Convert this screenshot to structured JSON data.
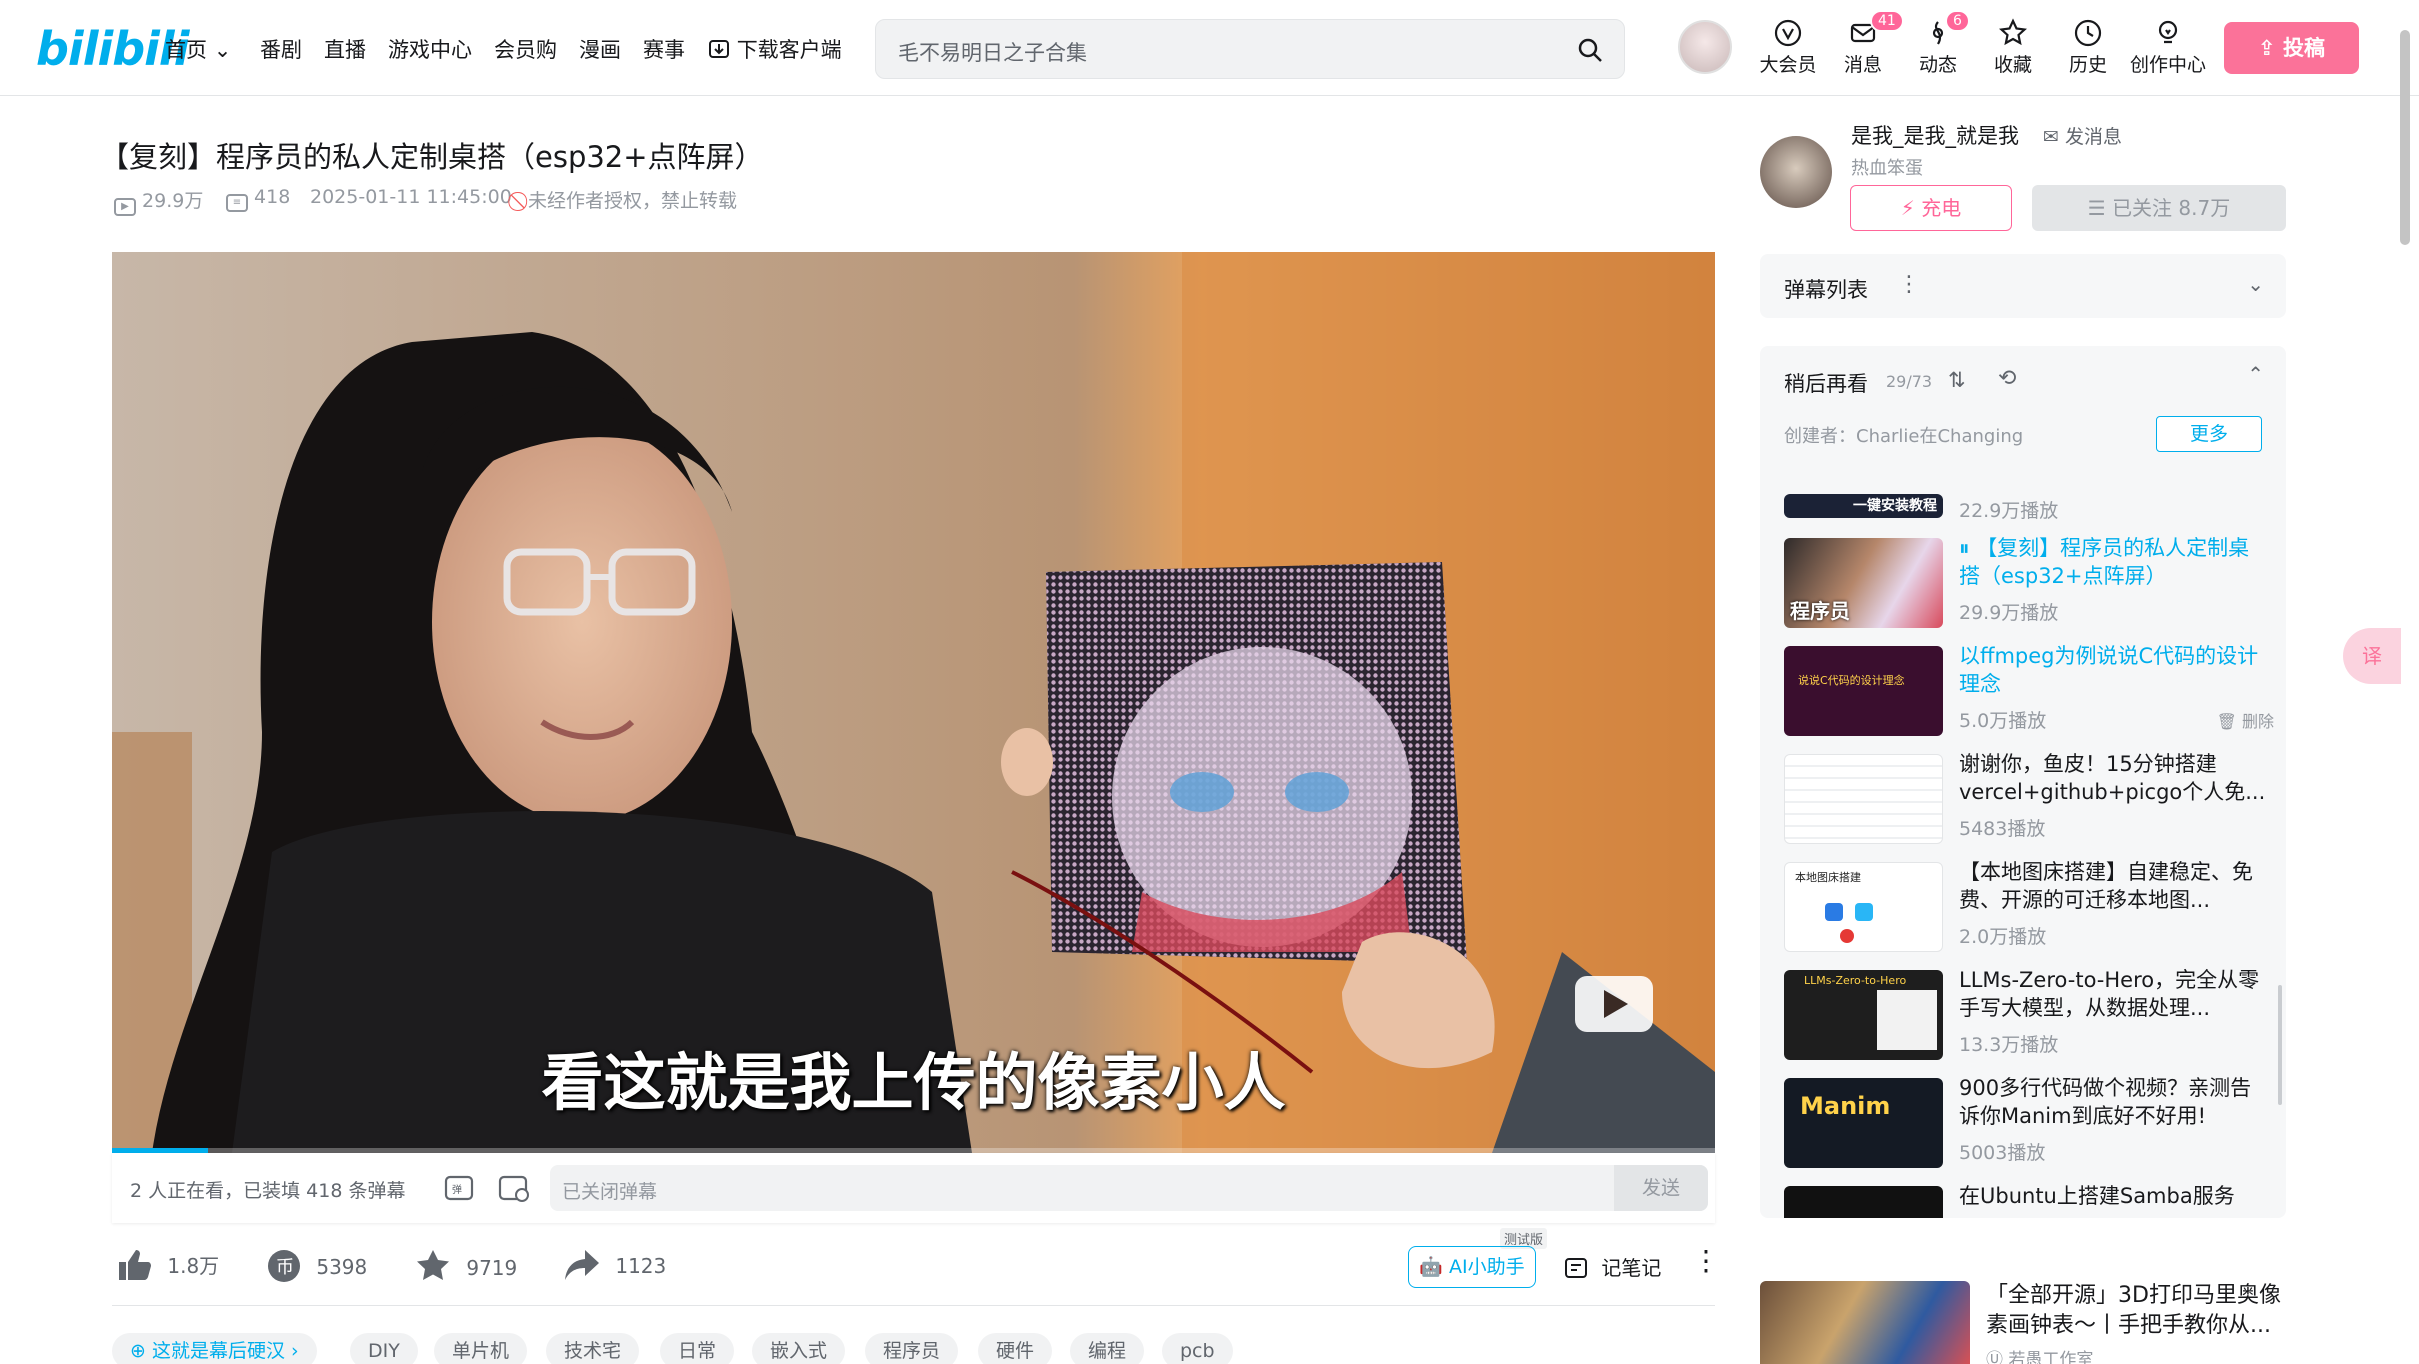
{
  "header": {
    "logo": "bilibili",
    "nav": [
      "首页",
      "番剧",
      "直播",
      "游戏中心",
      "会员购",
      "漫画",
      "赛事",
      "下载客户端"
    ],
    "search_placeholder": "毛不易明日之子合集",
    "icons": [
      {
        "name": "大会员",
        "icon": "vip-icon"
      },
      {
        "name": "消息",
        "icon": "message-icon",
        "badge": "41"
      },
      {
        "name": "动态",
        "icon": "dynamic-icon",
        "badge": "6"
      },
      {
        "name": "收藏",
        "icon": "favorite-icon"
      },
      {
        "name": "历史",
        "icon": "history-icon"
      },
      {
        "name": "创作中心",
        "icon": "creator-icon"
      }
    ],
    "upload": "投稿"
  },
  "video": {
    "title": "【复刻】程序员的私人定制桌搭（esp32+点阵屏）",
    "views": "29.9万",
    "danmaku": "418",
    "date": "2025-01-11 11:45:00",
    "copyright": "未经作者授权，禁止转载",
    "subtitle": "看这就是我上传的像素小人",
    "progress": 0.06
  },
  "danmaku_bar": {
    "viewers": "2 人正在看，已装填 418 条弹幕",
    "placeholder": "已关闭弹幕",
    "send": "发送"
  },
  "toolbar": {
    "like": "1.8万",
    "coin": "5398",
    "fav": "9719",
    "share": "1123",
    "ai": "AI小助手",
    "beta": "测试版",
    "note": "记笔记"
  },
  "tags": [
    "这就是幕后硬汉",
    "DIY",
    "单片机",
    "技术宅",
    "日常",
    "嵌入式",
    "程序员",
    "硬件",
    "编程",
    "pcb"
  ],
  "up": {
    "name": "是我_是我_就是我",
    "msg": "发消息",
    "desc": "热血笨蛋",
    "charge": "充电",
    "follow": "已关注 8.7万"
  },
  "danmaku_list": {
    "title": "弹幕列表"
  },
  "watch_later": {
    "title": "稍后再看",
    "count": "29/73",
    "creator": "创建者：Charlie在Changing",
    "more": "更多",
    "items": [
      {
        "title": "",
        "plays": "22.9万播放",
        "thumb_text": "一键安装教程"
      },
      {
        "title": "【复刻】程序员的私人定制桌搭（esp32+点阵屏）",
        "plays": "29.9万播放",
        "active": true,
        "thumb_text": "程序员"
      },
      {
        "title": "以ffmpeg为例说说C代码的设计理念",
        "plays": "5.0万播放",
        "active": true,
        "delete": "删除",
        "thumb_text": "说说C代码的设计理念"
      },
      {
        "title": "谢谢你，鱼皮！15分钟搭建vercel+github+picgo个人免...",
        "plays": "5483播放",
        "thumb_text": ""
      },
      {
        "title": "【本地图床搭建】自建稳定、免费、开源的可迁移本地图...",
        "plays": "2.0万播放",
        "thumb_text": "本地图床搭建"
      },
      {
        "title": "LLMs-Zero-to-Hero，完全从零手写大模型，从数据处理...",
        "plays": "13.3万播放",
        "thumb_text": "LLMs-Zero-to-Hero"
      },
      {
        "title": "900多行代码做个视频？亲测告诉你Manim到底好不好用!",
        "plays": "5003播放",
        "thumb_text": "Manim"
      },
      {
        "title": "在Ubuntu上搭建Samba服务",
        "plays": "",
        "thumb_text": ""
      }
    ]
  },
  "recommend": {
    "title": "「全部开源」3D打印马里奥像素画钟表～丨手把手教你从...",
    "author": "若愚工作室"
  },
  "float_btn": "译"
}
